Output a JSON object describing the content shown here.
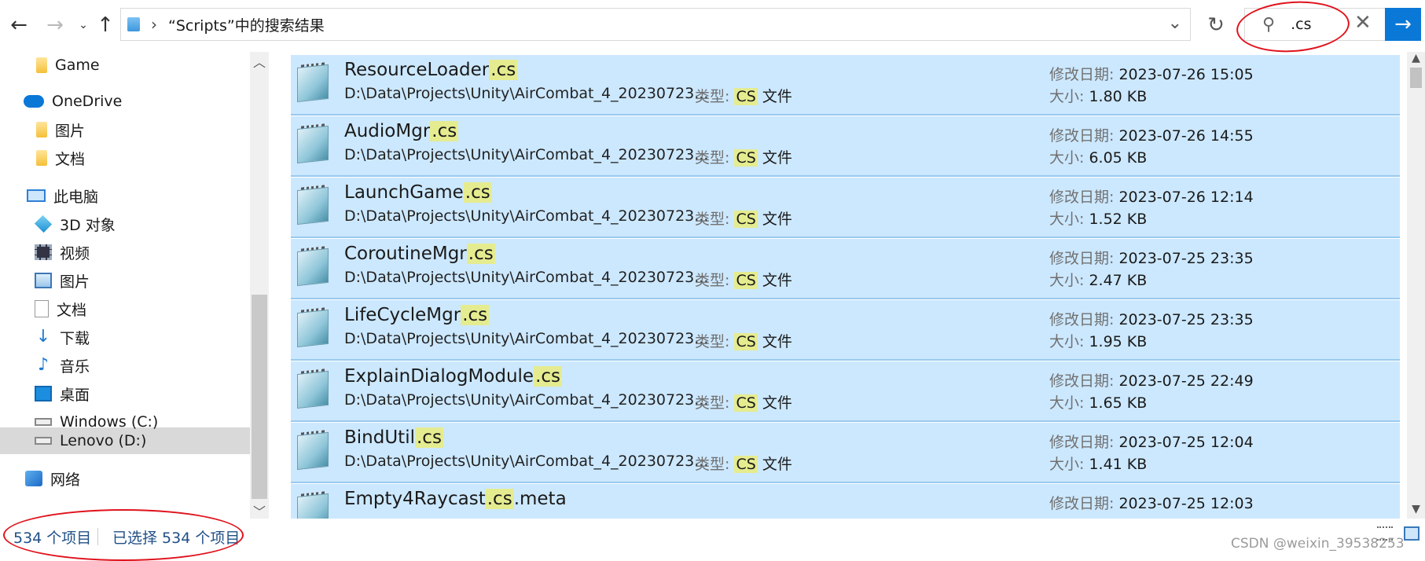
{
  "address_bar": {
    "breadcrumb": "“Scripts”中的搜索结果"
  },
  "search": {
    "value": ".cs"
  },
  "sidebar": {
    "items": [
      {
        "label": "Game",
        "icon": "folder-icon"
      },
      {
        "label": "OneDrive",
        "icon": "onedrive-icon"
      },
      {
        "label": "图片",
        "icon": "folder-icon"
      },
      {
        "label": "文档",
        "icon": "folder-icon"
      },
      {
        "label": "此电脑",
        "icon": "computer-icon"
      },
      {
        "label": "3D 对象",
        "icon": "3d-objects-icon"
      },
      {
        "label": "视频",
        "icon": "video-icon"
      },
      {
        "label": "图片",
        "icon": "pictures-icon"
      },
      {
        "label": "文档",
        "icon": "documents-icon"
      },
      {
        "label": "下载",
        "icon": "download-icon"
      },
      {
        "label": "音乐",
        "icon": "music-icon"
      },
      {
        "label": "桌面",
        "icon": "desktop-icon"
      },
      {
        "label": "Windows (C:)",
        "icon": "drive-icon"
      },
      {
        "label": "Lenovo (D:)",
        "icon": "drive-icon"
      },
      {
        "label": "网络",
        "icon": "network-icon"
      }
    ],
    "selected": "Lenovo (D:)"
  },
  "files": [
    {
      "name": "ResourceLoader",
      "ext": ".cs",
      "suffix": "",
      "path": "D:\\Data\\Projects\\Unity\\AirCombat_4_20230723...",
      "date": "2023-07-26 15:05",
      "size": "1.80 KB"
    },
    {
      "name": "AudioMgr",
      "ext": ".cs",
      "suffix": "",
      "path": "D:\\Data\\Projects\\Unity\\AirCombat_4_20230723...",
      "date": "2023-07-26 14:55",
      "size": "6.05 KB"
    },
    {
      "name": "LaunchGame",
      "ext": ".cs",
      "suffix": "",
      "path": "D:\\Data\\Projects\\Unity\\AirCombat_4_20230723...",
      "date": "2023-07-26 12:14",
      "size": "1.52 KB"
    },
    {
      "name": "CoroutineMgr",
      "ext": ".cs",
      "suffix": "",
      "path": "D:\\Data\\Projects\\Unity\\AirCombat_4_20230723...",
      "date": "2023-07-25 23:35",
      "size": "2.47 KB"
    },
    {
      "name": "LifeCycleMgr",
      "ext": ".cs",
      "suffix": "",
      "path": "D:\\Data\\Projects\\Unity\\AirCombat_4_20230723...",
      "date": "2023-07-25 23:35",
      "size": "1.95 KB"
    },
    {
      "name": "ExplainDialogModule",
      "ext": ".cs",
      "suffix": "",
      "path": "D:\\Data\\Projects\\Unity\\AirCombat_4_20230723...",
      "date": "2023-07-25 22:49",
      "size": "1.65 KB"
    },
    {
      "name": "BindUtil",
      "ext": ".cs",
      "suffix": "",
      "path": "D:\\Data\\Projects\\Unity\\AirCombat_4_20230723...",
      "date": "2023-07-25 12:04",
      "size": "1.41 KB"
    },
    {
      "name": "Empty4Raycast",
      "ext": ".cs",
      "suffix": ".meta",
      "path": "",
      "date": "2023-07-25 12:03",
      "size": ""
    }
  ],
  "labels": {
    "type_label": "类型: ",
    "type_ext": "CS",
    "type_suffix": " 文件",
    "date_label": "修改日期: ",
    "size_label": "大小: "
  },
  "status": {
    "item_count": "534 个项目",
    "selected_count": "已选择 534 个项目"
  },
  "watermark": "CSDN @weixin_39538253",
  "colors": {
    "selection_bg": "#cce8ff",
    "highlight": "#e5ec8f",
    "accent": "#0a78d7",
    "annotation_red": "#e0131d"
  }
}
